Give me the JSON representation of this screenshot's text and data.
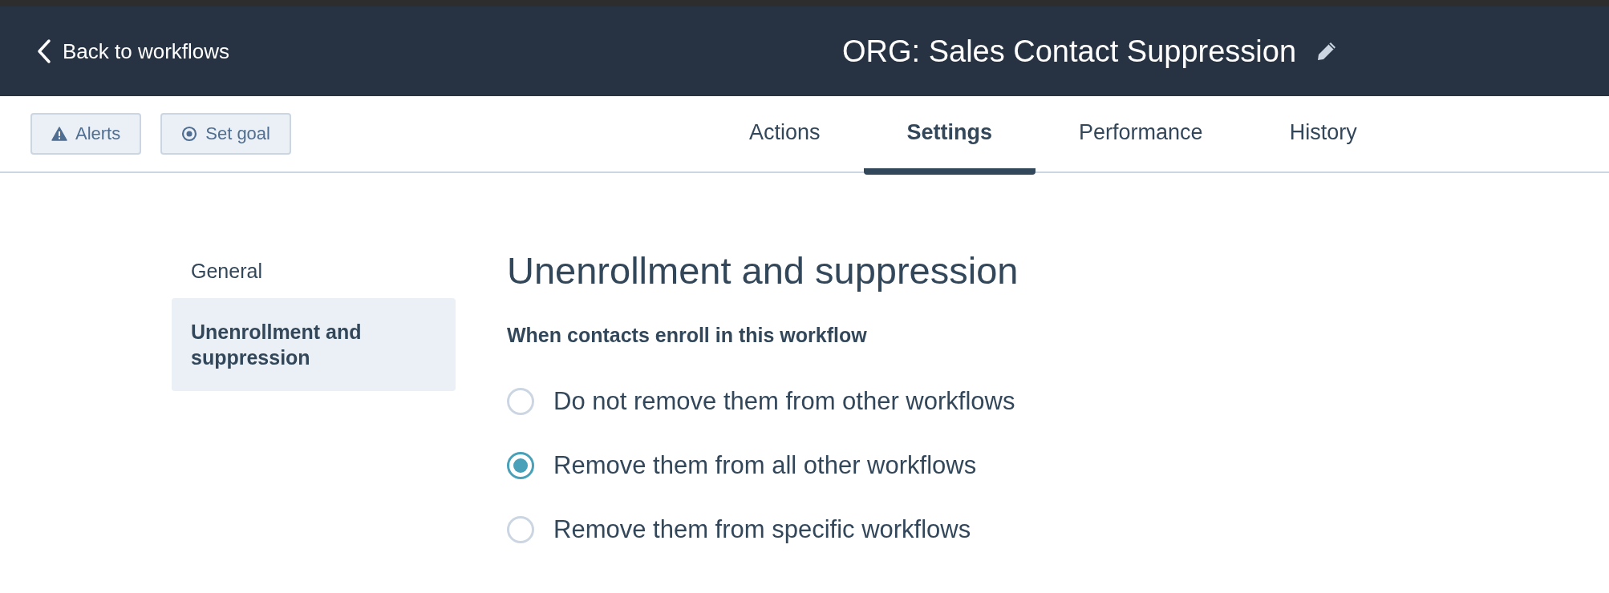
{
  "header": {
    "back_link": "Back to workflows",
    "title": "ORG: Sales Contact Suppression"
  },
  "toolbar": {
    "buttons": [
      {
        "kind": "alert",
        "label": "Alerts"
      },
      {
        "kind": "goal",
        "label": "Set goal"
      }
    ]
  },
  "tabs": [
    {
      "label": "Actions",
      "selected": false
    },
    {
      "label": "Settings",
      "selected": true
    },
    {
      "label": "Performance",
      "selected": false
    },
    {
      "label": "History",
      "selected": false
    }
  ],
  "sidebar": {
    "items": [
      {
        "label": "General",
        "selected": false
      },
      {
        "label": "Unenrollment and suppression",
        "selected": true
      }
    ]
  },
  "section": {
    "heading": "Unenrollment and suppression",
    "question": "When contacts enroll in this workflow",
    "options": [
      {
        "label": "Do not remove them from other workflows",
        "selected": false
      },
      {
        "label": "Remove them from all other workflows",
        "selected": true
      },
      {
        "label": "Remove them from specific workflows",
        "selected": false
      }
    ]
  }
}
